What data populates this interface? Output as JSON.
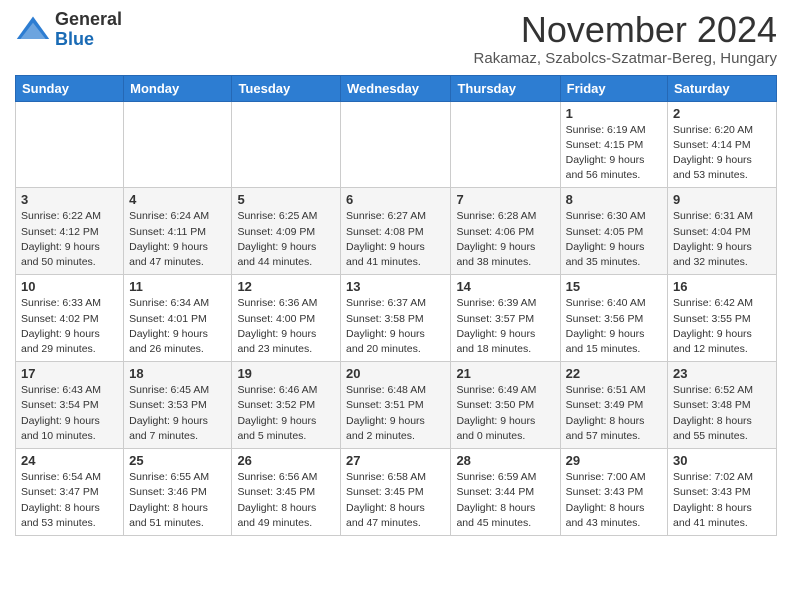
{
  "header": {
    "logo_general": "General",
    "logo_blue": "Blue",
    "month_title": "November 2024",
    "subtitle": "Rakamaz, Szabolcs-Szatmar-Bereg, Hungary"
  },
  "days_of_week": [
    "Sunday",
    "Monday",
    "Tuesday",
    "Wednesday",
    "Thursday",
    "Friday",
    "Saturday"
  ],
  "weeks": [
    [
      {
        "day": "",
        "info": ""
      },
      {
        "day": "",
        "info": ""
      },
      {
        "day": "",
        "info": ""
      },
      {
        "day": "",
        "info": ""
      },
      {
        "day": "",
        "info": ""
      },
      {
        "day": "1",
        "info": "Sunrise: 6:19 AM\nSunset: 4:15 PM\nDaylight: 9 hours\nand 56 minutes."
      },
      {
        "day": "2",
        "info": "Sunrise: 6:20 AM\nSunset: 4:14 PM\nDaylight: 9 hours\nand 53 minutes."
      }
    ],
    [
      {
        "day": "3",
        "info": "Sunrise: 6:22 AM\nSunset: 4:12 PM\nDaylight: 9 hours\nand 50 minutes."
      },
      {
        "day": "4",
        "info": "Sunrise: 6:24 AM\nSunset: 4:11 PM\nDaylight: 9 hours\nand 47 minutes."
      },
      {
        "day": "5",
        "info": "Sunrise: 6:25 AM\nSunset: 4:09 PM\nDaylight: 9 hours\nand 44 minutes."
      },
      {
        "day": "6",
        "info": "Sunrise: 6:27 AM\nSunset: 4:08 PM\nDaylight: 9 hours\nand 41 minutes."
      },
      {
        "day": "7",
        "info": "Sunrise: 6:28 AM\nSunset: 4:06 PM\nDaylight: 9 hours\nand 38 minutes."
      },
      {
        "day": "8",
        "info": "Sunrise: 6:30 AM\nSunset: 4:05 PM\nDaylight: 9 hours\nand 35 minutes."
      },
      {
        "day": "9",
        "info": "Sunrise: 6:31 AM\nSunset: 4:04 PM\nDaylight: 9 hours\nand 32 minutes."
      }
    ],
    [
      {
        "day": "10",
        "info": "Sunrise: 6:33 AM\nSunset: 4:02 PM\nDaylight: 9 hours\nand 29 minutes."
      },
      {
        "day": "11",
        "info": "Sunrise: 6:34 AM\nSunset: 4:01 PM\nDaylight: 9 hours\nand 26 minutes."
      },
      {
        "day": "12",
        "info": "Sunrise: 6:36 AM\nSunset: 4:00 PM\nDaylight: 9 hours\nand 23 minutes."
      },
      {
        "day": "13",
        "info": "Sunrise: 6:37 AM\nSunset: 3:58 PM\nDaylight: 9 hours\nand 20 minutes."
      },
      {
        "day": "14",
        "info": "Sunrise: 6:39 AM\nSunset: 3:57 PM\nDaylight: 9 hours\nand 18 minutes."
      },
      {
        "day": "15",
        "info": "Sunrise: 6:40 AM\nSunset: 3:56 PM\nDaylight: 9 hours\nand 15 minutes."
      },
      {
        "day": "16",
        "info": "Sunrise: 6:42 AM\nSunset: 3:55 PM\nDaylight: 9 hours\nand 12 minutes."
      }
    ],
    [
      {
        "day": "17",
        "info": "Sunrise: 6:43 AM\nSunset: 3:54 PM\nDaylight: 9 hours\nand 10 minutes."
      },
      {
        "day": "18",
        "info": "Sunrise: 6:45 AM\nSunset: 3:53 PM\nDaylight: 9 hours\nand 7 minutes."
      },
      {
        "day": "19",
        "info": "Sunrise: 6:46 AM\nSunset: 3:52 PM\nDaylight: 9 hours\nand 5 minutes."
      },
      {
        "day": "20",
        "info": "Sunrise: 6:48 AM\nSunset: 3:51 PM\nDaylight: 9 hours\nand 2 minutes."
      },
      {
        "day": "21",
        "info": "Sunrise: 6:49 AM\nSunset: 3:50 PM\nDaylight: 9 hours\nand 0 minutes."
      },
      {
        "day": "22",
        "info": "Sunrise: 6:51 AM\nSunset: 3:49 PM\nDaylight: 8 hours\nand 57 minutes."
      },
      {
        "day": "23",
        "info": "Sunrise: 6:52 AM\nSunset: 3:48 PM\nDaylight: 8 hours\nand 55 minutes."
      }
    ],
    [
      {
        "day": "24",
        "info": "Sunrise: 6:54 AM\nSunset: 3:47 PM\nDaylight: 8 hours\nand 53 minutes."
      },
      {
        "day": "25",
        "info": "Sunrise: 6:55 AM\nSunset: 3:46 PM\nDaylight: 8 hours\nand 51 minutes."
      },
      {
        "day": "26",
        "info": "Sunrise: 6:56 AM\nSunset: 3:45 PM\nDaylight: 8 hours\nand 49 minutes."
      },
      {
        "day": "27",
        "info": "Sunrise: 6:58 AM\nSunset: 3:45 PM\nDaylight: 8 hours\nand 47 minutes."
      },
      {
        "day": "28",
        "info": "Sunrise: 6:59 AM\nSunset: 3:44 PM\nDaylight: 8 hours\nand 45 minutes."
      },
      {
        "day": "29",
        "info": "Sunrise: 7:00 AM\nSunset: 3:43 PM\nDaylight: 8 hours\nand 43 minutes."
      },
      {
        "day": "30",
        "info": "Sunrise: 7:02 AM\nSunset: 3:43 PM\nDaylight: 8 hours\nand 41 minutes."
      }
    ]
  ]
}
